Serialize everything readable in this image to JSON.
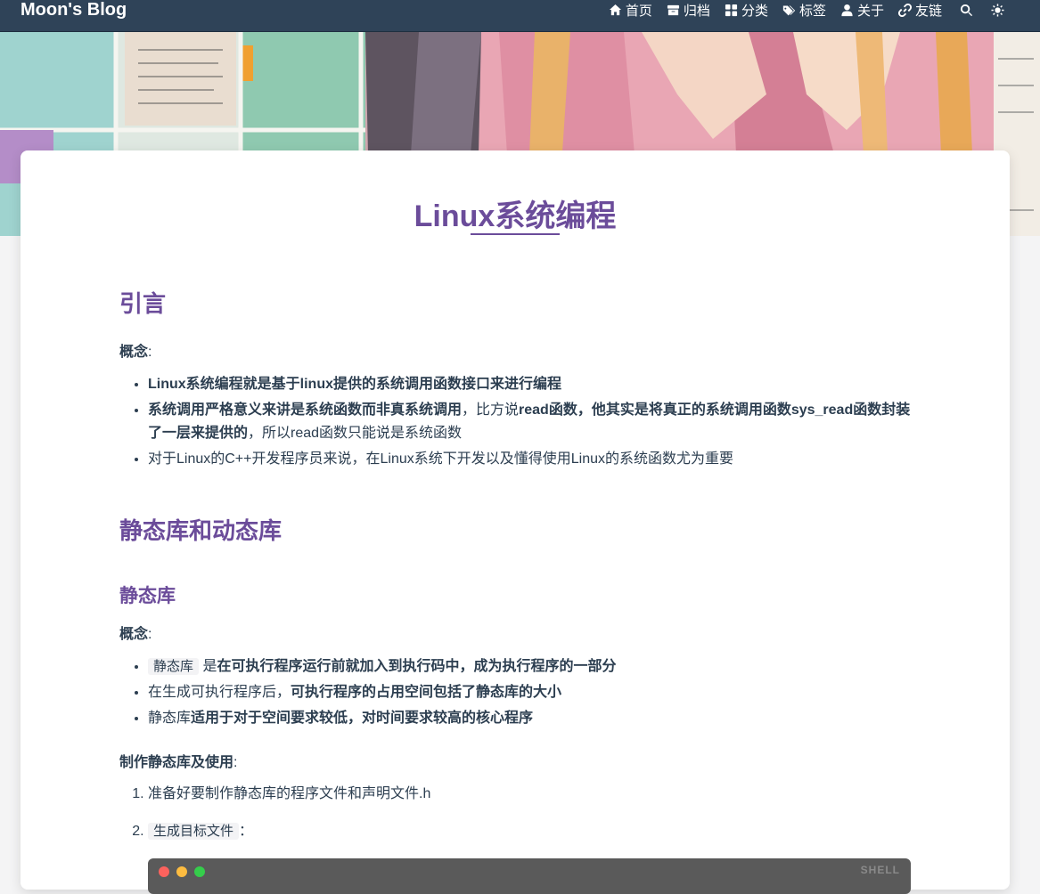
{
  "nav": {
    "brand": "Moon's Blog",
    "items": [
      {
        "label": "首页",
        "icon": "home-icon"
      },
      {
        "label": "归档",
        "icon": "archive-icon"
      },
      {
        "label": "分类",
        "icon": "grid-icon"
      },
      {
        "label": "标签",
        "icon": "tags-icon"
      },
      {
        "label": "关于",
        "icon": "user-icon"
      },
      {
        "label": "友链",
        "icon": "link-icon"
      }
    ],
    "search_icon": "search-icon",
    "theme_icon": "sun-icon"
  },
  "post": {
    "title": "Linux系统编程",
    "sections": {
      "intro": {
        "heading": "引言",
        "concept_label": "概念",
        "colon": ":",
        "bullet1": "Linux系统编程就是基于linux提供的系统调用函数接口来进行编程",
        "bullet2_bold1": "系统调用严格意义来讲是系统函数而非真系统调用",
        "bullet2_text1": "，比方说",
        "bullet2_bold2": "read函数，他其实是将真正的系统调用函数sys_read函数封装了一层来提供的",
        "bullet2_text2": "，所以read函数只能说是系统函数",
        "bullet3": "对于Linux的C++开发程序员来说，在Linux系统下开发以及懂得使用Linux的系统函数尤为重要"
      },
      "libs": {
        "heading": "静态库和动态库",
        "static_heading": "静态库",
        "concept_label": "概念",
        "colon": ":",
        "b1_code": "静态库",
        "b1_text": " 是",
        "b1_bold": "在可执行程序运行前就加入到执行码中，成为执行程序的一部分",
        "b2_text": "在生成可执行程序后，",
        "b2_bold": "可执行程序的占用空间包括了静态库的大小",
        "b3_text": "静态库",
        "b3_bold": "适用于对于空间要求较低，对时间要求较高的核心程序",
        "make_label": "制作静态库及使用",
        "step1": "准备好要制作静态库的程序文件和声明文件.h",
        "step2_code": "生成目标文件",
        "step2_colon": "："
      }
    },
    "codeblock_lang": "SHELL"
  },
  "colors": {
    "accent": "#6b4c9a",
    "navbar": "#2f4358",
    "text": "#2c3e50"
  }
}
